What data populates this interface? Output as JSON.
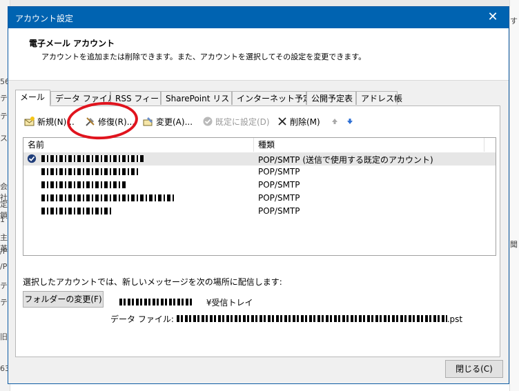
{
  "window": {
    "title": "アカウント設定",
    "close_glyph": "✕"
  },
  "header": {
    "title": "電子メール アカウント",
    "description": "アカウントを追加または削除できます。また、アカウントを選択してその設定を変更できます。"
  },
  "tabs": [
    {
      "label": "メール",
      "active": true
    },
    {
      "label": "データ ファイル"
    },
    {
      "label": "RSS フィード"
    },
    {
      "label": "SharePoint リスト"
    },
    {
      "label": "インターネット予定表"
    },
    {
      "label": "公開予定表"
    },
    {
      "label": "アドレス帳"
    }
  ],
  "toolbar": {
    "new": "新規(N)...",
    "repair": "修復(R)...",
    "change": "変更(A)...",
    "set_default": "既定に設定(D)",
    "delete": "削除(M)"
  },
  "list": {
    "col_name": "名前",
    "col_type": "種類",
    "rows": [
      {
        "type": "POP/SMTP (送信で使用する既定のアカウント)",
        "default": true
      },
      {
        "type": "POP/SMTP"
      },
      {
        "type": "POP/SMTP"
      },
      {
        "type": "POP/SMTP"
      },
      {
        "type": "POP/SMTP"
      }
    ]
  },
  "delivery": {
    "label": "選択したアカウントでは、新しいメッセージを次の場所に配信します:",
    "change_folder": "フォルダーの変更(F)",
    "folder_suffix": "¥受信トレイ",
    "datafile_label": "データ ファイル:",
    "datafile_ext": ".pst"
  },
  "footer": {
    "close": "閉じる(C)"
  },
  "colors": {
    "titlebar": "#0063b1",
    "annotation": "#e0141e",
    "arrow": "#2d6fd4"
  },
  "background": {
    "left_hints": [
      "56",
      "テ",
      "テ",
      "ス",
      "会社",
      "定鎖",
      "1",
      "主英",
      "/P",
      "/P",
      "テ",
      "テ",
      "旧",
      "63"
    ],
    "right_hints": [
      "す",
      "聞"
    ]
  }
}
